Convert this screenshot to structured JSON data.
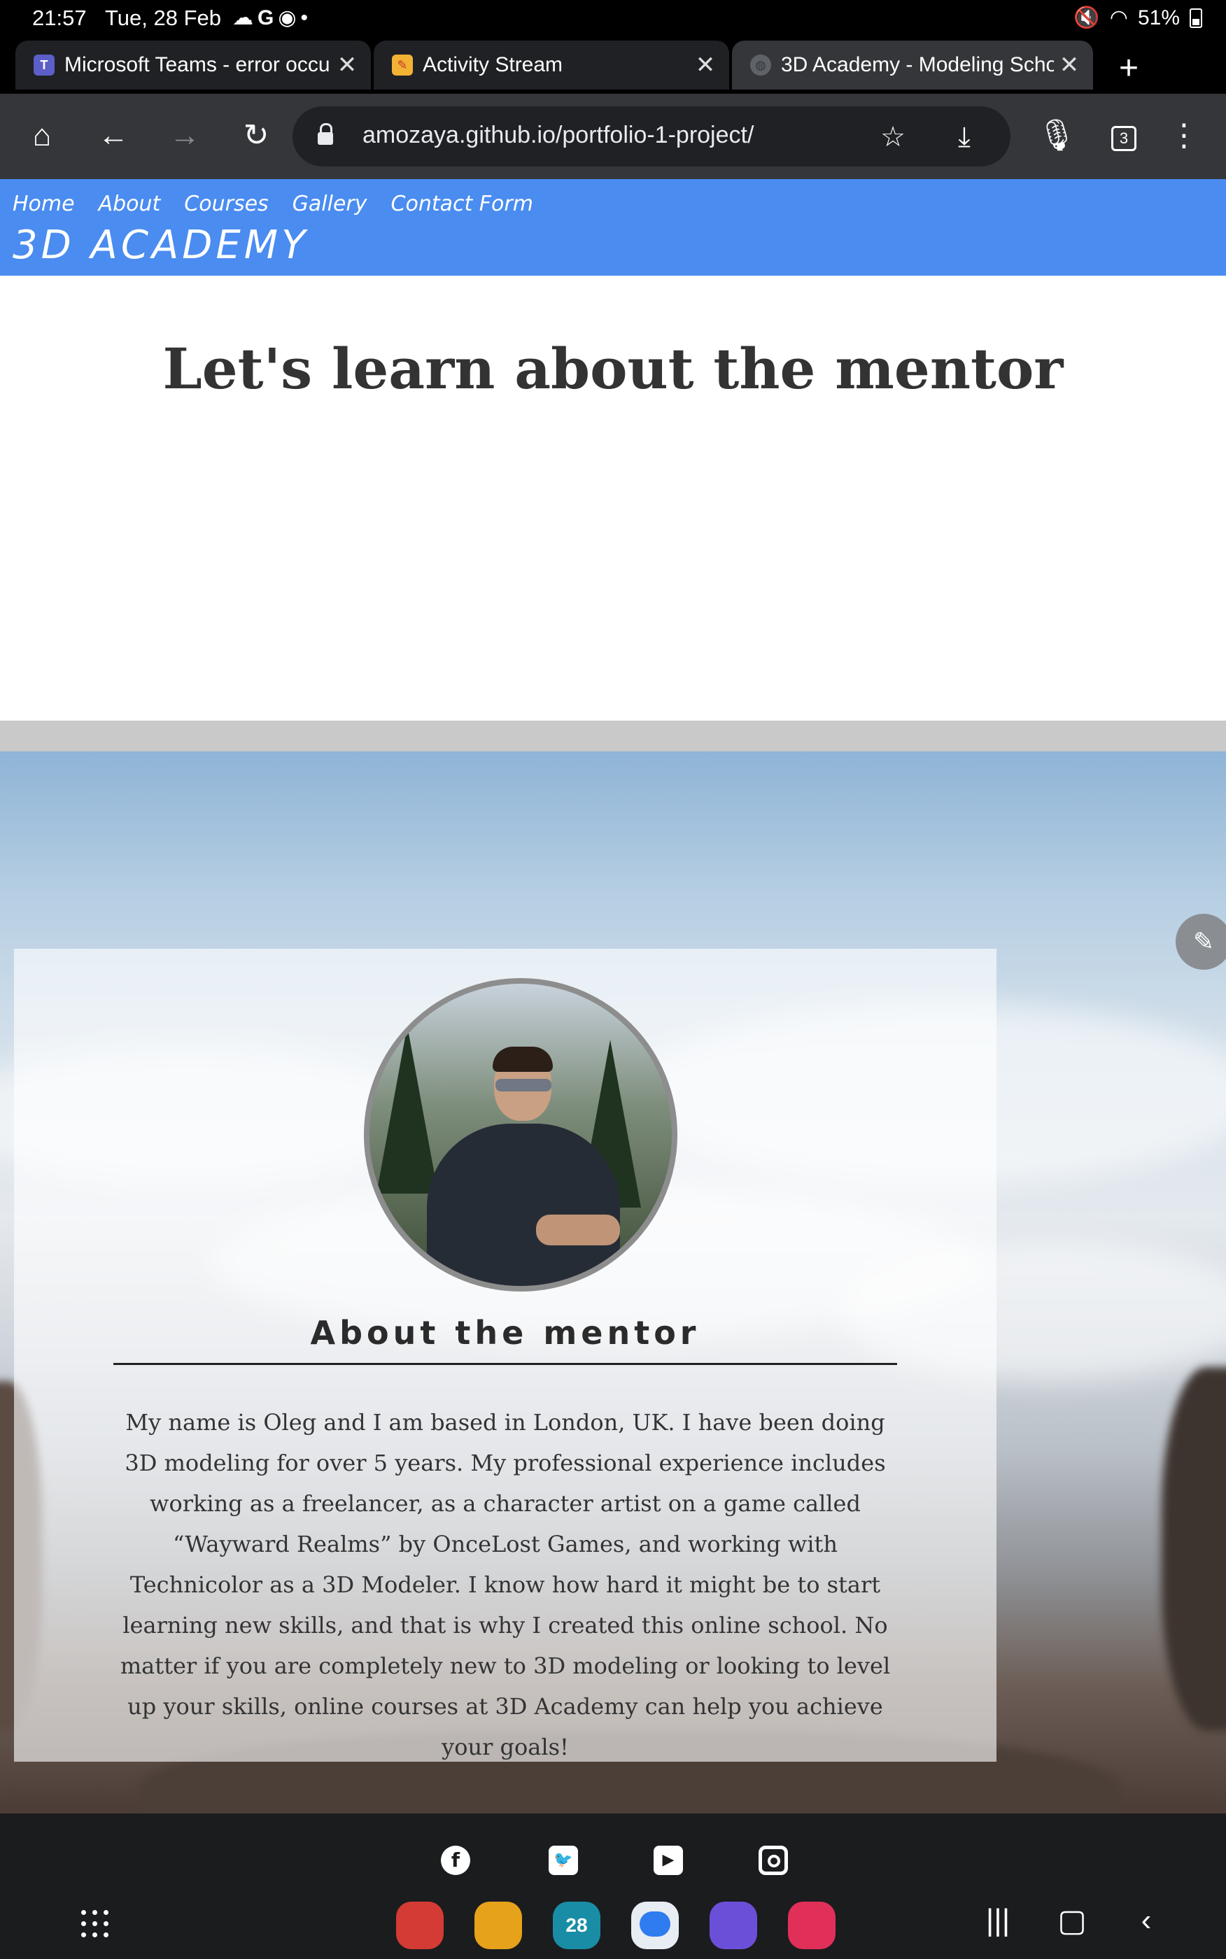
{
  "status_bar": {
    "time": "21:57",
    "date": "Tue, 28 Feb",
    "battery": "51%"
  },
  "tabs": [
    {
      "title": "Microsoft Teams - error occu",
      "favicon": "teams-icon",
      "active": false
    },
    {
      "title": "Activity Stream",
      "favicon": "pencil-note-icon",
      "active": false
    },
    {
      "title": "3D Academy - Modeling Scho",
      "favicon": "globe-icon",
      "active": true
    }
  ],
  "tab_count": "3",
  "address_bar": {
    "url": "amozaya.github.io/portfolio-1-project/"
  },
  "site_nav": {
    "links": [
      "Home",
      "About",
      "Courses",
      "Gallery",
      "Contact Form"
    ],
    "brand": "3D ACADEMY"
  },
  "main": {
    "title": "Let's learn about the mentor"
  },
  "mentor": {
    "heading": "About the mentor",
    "bio": "My name is Oleg and I am based in London, UK. I have been doing 3D modeling for over 5 years. My professional experience includes working as a freelancer, as a character artist on a game called “Wayward Realms” by OnceLost Games, and working with Technicolor as a 3D Modeler. I know how hard it might be to start learning new skills, and that is why I created this online school. No matter if you are completely new to 3D modeling or looking to level up your skills, online courses at 3D Academy can help you achieve your goals!"
  },
  "footer": {
    "social": [
      "facebook-icon",
      "twitter-icon",
      "youtube-icon",
      "instagram-icon"
    ]
  },
  "dock": {
    "calendar_day": "28",
    "colors": {
      "accent_blue": "#4a8cf0",
      "dock_red": "#d33b34",
      "dock_yellow": "#e6a21a",
      "dock_teal": "#1a8da6",
      "dock_chat": "#2f7bf0",
      "dock_purple": "#6c4fd8",
      "dock_pink": "#e0305a"
    }
  }
}
